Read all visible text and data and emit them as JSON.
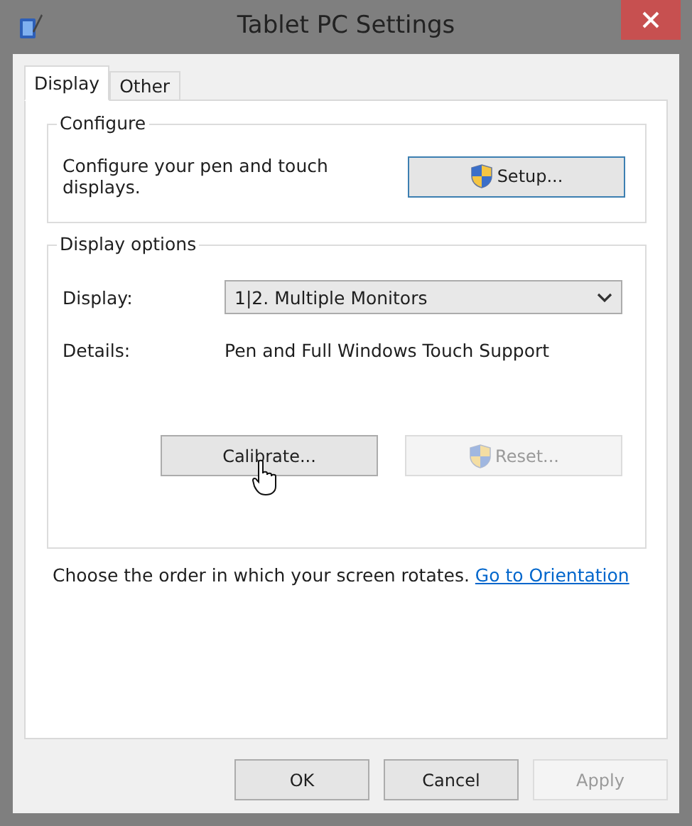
{
  "window": {
    "title": "Tablet PC Settings"
  },
  "tabs": [
    {
      "label": "Display",
      "selected": true
    },
    {
      "label": "Other",
      "selected": false
    }
  ],
  "configure": {
    "title": "Configure",
    "description": "Configure your pen and touch displays.",
    "button": {
      "label": "Setup...",
      "shield": true,
      "disabled": false,
      "default": true
    }
  },
  "display_options": {
    "title": "Display options",
    "display_label": "Display:",
    "display_value": "1|2. Multiple Monitors",
    "details_label": "Details:",
    "details_value": "Pen and Full Windows Touch Support",
    "buttons": [
      {
        "label": "Calibrate...",
        "shield": false,
        "disabled": false,
        "default": false
      },
      {
        "label": "Reset...",
        "shield": true,
        "disabled": true,
        "default": false
      }
    ]
  },
  "orientation": {
    "text": "Choose the order in which your screen rotates.",
    "link": "Go to Orientation"
  },
  "buttons": [
    {
      "label": "OK",
      "disabled": false
    },
    {
      "label": "Cancel",
      "disabled": false
    },
    {
      "label": "Apply",
      "disabled": true
    }
  ]
}
